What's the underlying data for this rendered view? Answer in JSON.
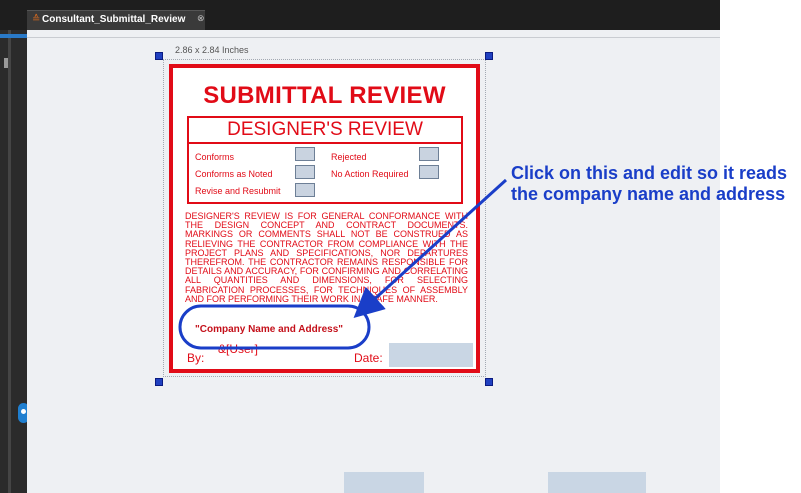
{
  "tab": {
    "title": "Consultant_Submittal_Review",
    "icon": "stamp-icon",
    "close_icon": "close-icon"
  },
  "canvas": {
    "size_label": "2.86 x 2.84 Inches"
  },
  "stamp": {
    "title": "SUBMITTAL REVIEW",
    "section_title": "DESIGNER'S REVIEW",
    "options": {
      "conforms": "Conforms",
      "rejected": "Rejected",
      "conforms_as_noted": "Conforms as Noted",
      "no_action_required": "No Action Required",
      "revise_and_resubmit": "Revise and Resubmit"
    },
    "body_text": "DESIGNER'S REVIEW IS FOR GENERAL CONFORMANCE WITH THE DESIGN CONCEPT AND CONTRACT DOCUMENTS. MARKINGS OR COMMENTS SHALL NOT BE CONSTRUED AS RELIEVING THE CONTRACTOR FROM COMPLIANCE WITH THE PROJECT PLANS AND SPECIFICATIONS, NOR DEPARTURES THEREFROM. THE CONTRACTOR REMAINS RESPONSIBLE FOR DETAILS AND ACCURACY, FOR CONFIRMING AND CORRELATING ALL QUANTITIES AND DIMENSIONS, FOR SELECTING FABRICATION PROCESSES, FOR TECHNIQUES OF ASSEMBLY AND FOR PERFORMING THEIR WORK IN A SAFE MANNER.",
    "company_placeholder": "\"Company Name and Address\"",
    "by_label": "By:",
    "user_field": "&[User]",
    "date_label": "Date:"
  },
  "annotation": {
    "callout": "Click on this and edit so it reads the company name and address",
    "color": "#1a3ec8"
  },
  "colors": {
    "stamp_red": "#e10b17",
    "field_fill": "#c9d6e4",
    "accent_blue": "#1a3ec8"
  }
}
